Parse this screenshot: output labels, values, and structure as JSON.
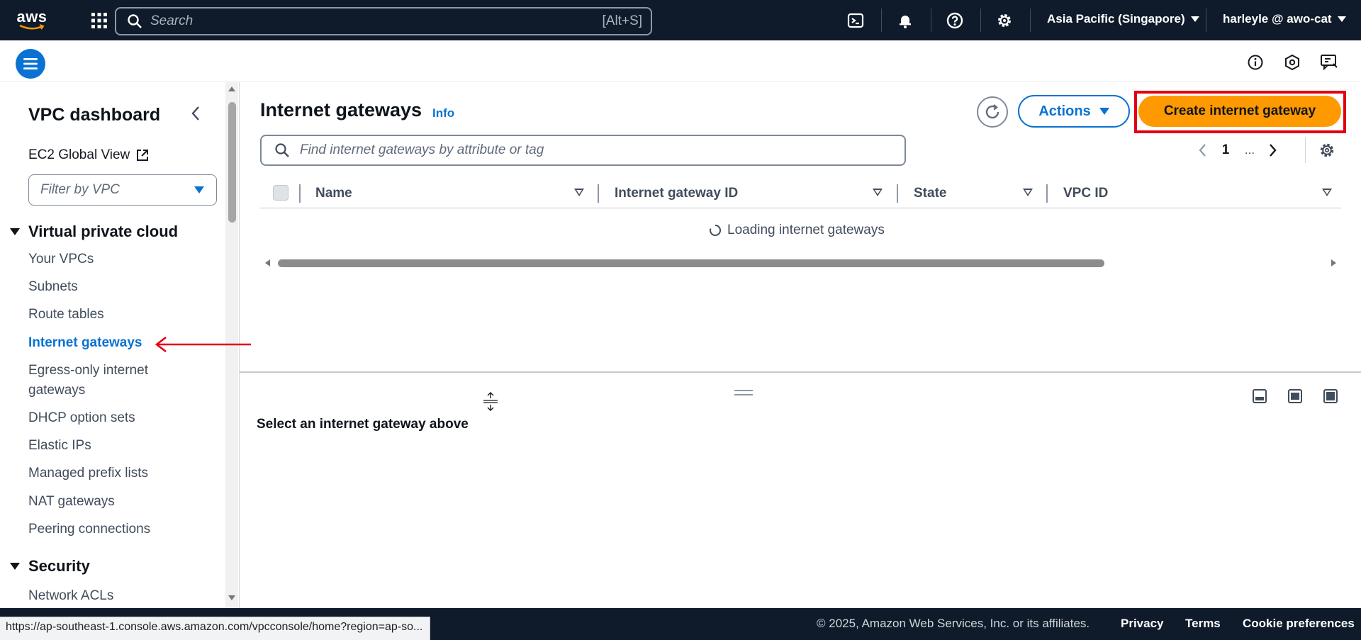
{
  "topnav": {
    "logo_text": "aws",
    "search_placeholder": "Search",
    "search_shortcut": "[Alt+S]",
    "region": "Asia Pacific (Singapore)",
    "account": "harleyle @ awo-cat",
    "icons": [
      "services-grid-icon",
      "cloudshell-icon",
      "bell-icon",
      "help-icon",
      "gear-icon"
    ]
  },
  "sidebar": {
    "title": "VPC dashboard",
    "global_view": "EC2 Global View",
    "filter_placeholder": "Filter by VPC",
    "sections": [
      {
        "label": "Virtual private cloud",
        "items": [
          {
            "label": "Your VPCs"
          },
          {
            "label": "Subnets"
          },
          {
            "label": "Route tables"
          },
          {
            "label": "Internet gateways",
            "active": true
          },
          {
            "label": "Egress-only internet gateways"
          },
          {
            "label": "DHCP option sets"
          },
          {
            "label": "Elastic IPs"
          },
          {
            "label": "Managed prefix lists"
          },
          {
            "label": "NAT gateways"
          },
          {
            "label": "Peering connections"
          }
        ]
      },
      {
        "label": "Security",
        "items": [
          {
            "label": "Network ACLs"
          }
        ]
      }
    ]
  },
  "main": {
    "title": "Internet gateways",
    "info_label": "Info",
    "actions_label": "Actions",
    "create_label": "Create internet gateway",
    "search_placeholder": "Find internet gateways by attribute or tag",
    "pagination": {
      "current_page": "1",
      "ellipsis": "..."
    },
    "columns": [
      "Name",
      "Internet gateway ID",
      "State",
      "VPC ID"
    ],
    "loading_text": "Loading internet gateways"
  },
  "split_panel": {
    "message": "Select an internet gateway above"
  },
  "footer": {
    "copyright": "© 2025, Amazon Web Services, Inc. or its affiliates.",
    "privacy": "Privacy",
    "terms": "Terms",
    "cookies": "Cookie preferences"
  },
  "status_bar": {
    "url": "https://ap-southeast-1.console.aws.amazon.com/vpcconsole/home?region=ap-so..."
  },
  "colors": {
    "nav_bg": "#0f1b2a",
    "link_blue": "#0972d3",
    "primary_orange": "#ff9900",
    "annotation_red": "#e3000f"
  }
}
